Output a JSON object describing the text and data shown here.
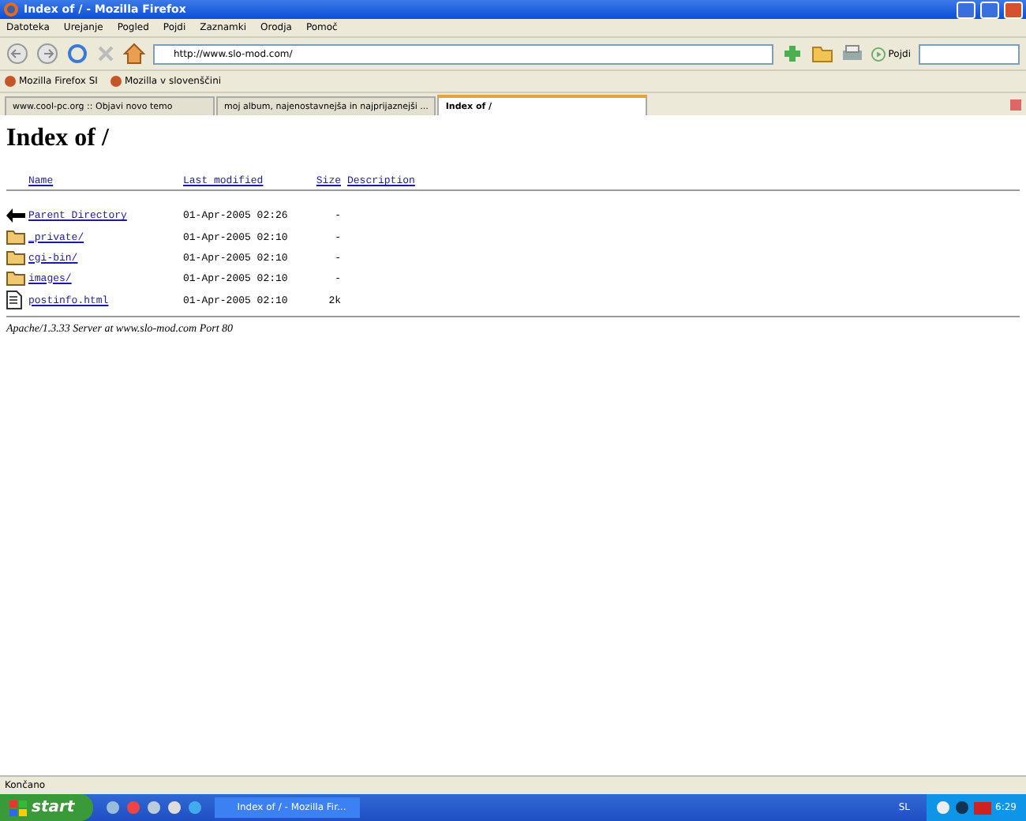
{
  "window": {
    "title": "Index of / - Mozilla Firefox"
  },
  "menu": [
    "Datoteka",
    "Urejanje",
    "Pogled",
    "Pojdi",
    "Zaznamki",
    "Orodja",
    "Pomoč"
  ],
  "toolbar": {
    "url": "http://www.slo-mod.com/",
    "go_label": "Pojdi"
  },
  "bookmarks": [
    "Mozilla Firefox SI",
    "Mozilla v slovenščini"
  ],
  "tabs": [
    {
      "label": "www.cool-pc.org :: Objavi novo temo",
      "selected": false
    },
    {
      "label": "moj album, najenostavnejša in najprijaznejši ...",
      "selected": false
    },
    {
      "label": "Index of /",
      "selected": true
    }
  ],
  "page": {
    "heading": "Index of /",
    "columns": [
      "Name",
      "Last modified",
      "Size",
      "Description"
    ],
    "rows": [
      {
        "kind": "parent",
        "name": "Parent Directory",
        "modified": "01-Apr-2005 02:26",
        "size": "-"
      },
      {
        "kind": "folder",
        "name": "_private/",
        "modified": "01-Apr-2005 02:10",
        "size": "-"
      },
      {
        "kind": "folder",
        "name": "cgi-bin/",
        "modified": "01-Apr-2005 02:10",
        "size": "-"
      },
      {
        "kind": "folder",
        "name": "images/",
        "modified": "01-Apr-2005 02:10",
        "size": "-"
      },
      {
        "kind": "file",
        "name": "postinfo.html",
        "modified": "01-Apr-2005 02:10",
        "size": "2k"
      }
    ],
    "footer": "Apache/1.3.33 Server at www.slo-mod.com Port 80"
  },
  "status_bar": "Končano",
  "taskbar": {
    "start": "start",
    "task": "Index of / - Mozilla Fir...",
    "language": "SL",
    "time": "6:29"
  }
}
